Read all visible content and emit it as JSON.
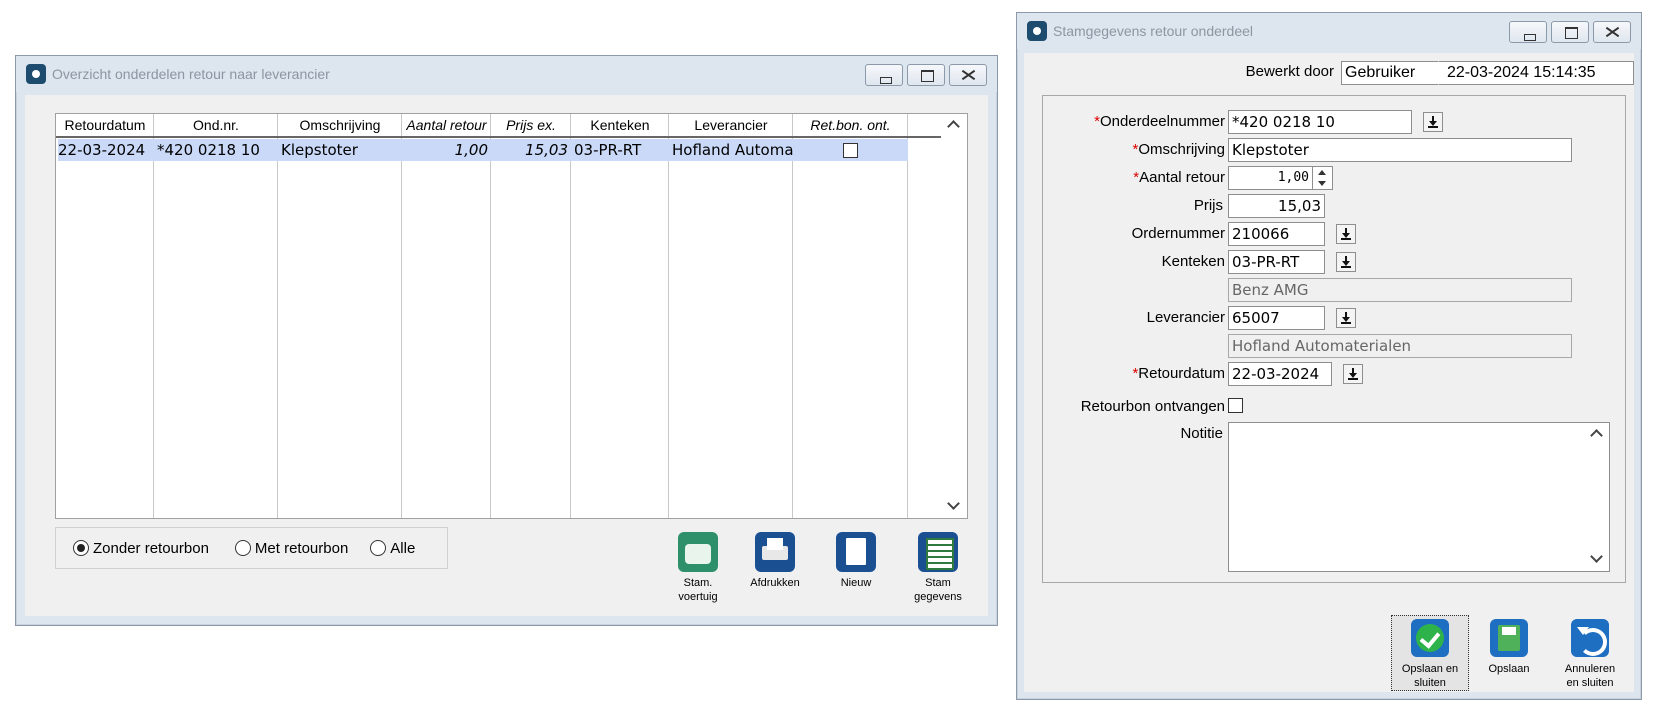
{
  "overview": {
    "title": "Overzicht onderdelen retour naar leverancier",
    "columns": [
      "Retourdatum",
      "Ond.nr.",
      "Omschrijving",
      "Aantal retour",
      "Prijs ex.",
      "Kenteken",
      "Leverancier",
      "Ret.bon. ont."
    ],
    "rows": [
      {
        "retourdatum": "22-03-2024",
        "ondnr": "*420 0218 10",
        "omschrijving": "Klepstoter",
        "aantal": "1,00",
        "prijs": "15,03",
        "kenteken": "03-PR-RT",
        "leverancier": "Hofland Automa"
      }
    ],
    "filters": [
      "Zonder retourbon",
      "Met retourbon",
      "Alle"
    ],
    "selected_filter": "Zonder retourbon",
    "tools": [
      {
        "line1": "Stam.",
        "line2": "voertuig"
      },
      {
        "line1": "Afdrukken",
        "line2": ""
      },
      {
        "line1": "Nieuw",
        "line2": ""
      },
      {
        "line1": "Stam",
        "line2": "gegevens"
      }
    ]
  },
  "detail": {
    "title": "Stamgegevens retour onderdeel",
    "bewerkt_door_label": "Bewerkt door",
    "bewerkt_door_user": "Gebruiker",
    "bewerkt_door_date": "22-03-2024 15:14:35",
    "labels": {
      "onderdeelnummer": "Onderdeelnummer",
      "omschrijving": "Omschrijving",
      "aantal_retour": "Aantal retour",
      "prijs": "Prijs",
      "ordernummer": "Ordernummer",
      "kenteken": "Kenteken",
      "leverancier": "Leverancier",
      "retourdatum": "Retourdatum",
      "retourbon_ontvangen": "Retourbon ontvangen",
      "notitie": "Notitie"
    },
    "required_mark": "*",
    "values": {
      "onderdeelnummer": "*420 0218 10",
      "omschrijving": "Klepstoter",
      "aantal_retour": "1,00",
      "prijs": "15,03",
      "ordernummer": "210066",
      "kenteken": "03-PR-RT",
      "kenteken_desc": "Benz AMG",
      "leverancier": "65007",
      "leverancier_desc": "Hofland Automaterialen",
      "retourdatum": "22-03-2024",
      "notitie": ""
    },
    "buttons": [
      {
        "line1": "Opslaan en",
        "line2": "sluiten"
      },
      {
        "line1": "Opslaan",
        "line2": ""
      },
      {
        "line1": "Annuleren",
        "line2": "en sluiten"
      }
    ]
  }
}
